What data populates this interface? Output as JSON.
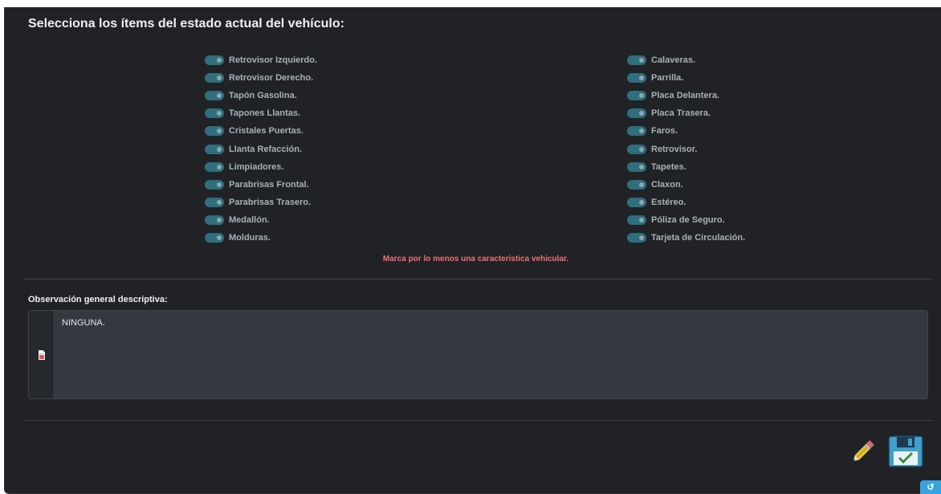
{
  "title": "Selecciona los ítems del estado actual del vehículo:",
  "items_left": [
    {
      "label": "Retrovisor Izquierdo."
    },
    {
      "label": "Retrovisor Derecho."
    },
    {
      "label": "Tapón Gasolina."
    },
    {
      "label": "Tapones Llantas."
    },
    {
      "label": "Cristales Puertas."
    },
    {
      "label": "Llanta Refacción."
    },
    {
      "label": "Limpiadores."
    },
    {
      "label": "Parabrisas Frontal."
    },
    {
      "label": "Parabrisas Trasero."
    },
    {
      "label": "Medallón."
    },
    {
      "label": "Molduras."
    }
  ],
  "items_right": [
    {
      "label": "Calaveras."
    },
    {
      "label": "Parrilla."
    },
    {
      "label": "Placa Delantera."
    },
    {
      "label": "Placa Trasera."
    },
    {
      "label": "Faros."
    },
    {
      "label": "Retrovisor."
    },
    {
      "label": "Tapetes."
    },
    {
      "label": "Claxon."
    },
    {
      "label": "Estéreo."
    },
    {
      "label": "Póliza de Seguro."
    },
    {
      "label": "Tarjeta de Circulación."
    }
  ],
  "warning": "Marca por lo menos una caracteristica vehicular.",
  "observation": {
    "label": "Observación general descriptiva:",
    "value": "NINGUNA."
  },
  "colors": {
    "panel_bg": "#202226",
    "toggle": "#2f6e7d",
    "warning": "#f06f73",
    "accent": "#38a4dd"
  },
  "icons": {
    "observation": "document-icon",
    "edit": "pencil-icon",
    "save": "floppy-disk-icon",
    "corner": "expand-icon"
  }
}
